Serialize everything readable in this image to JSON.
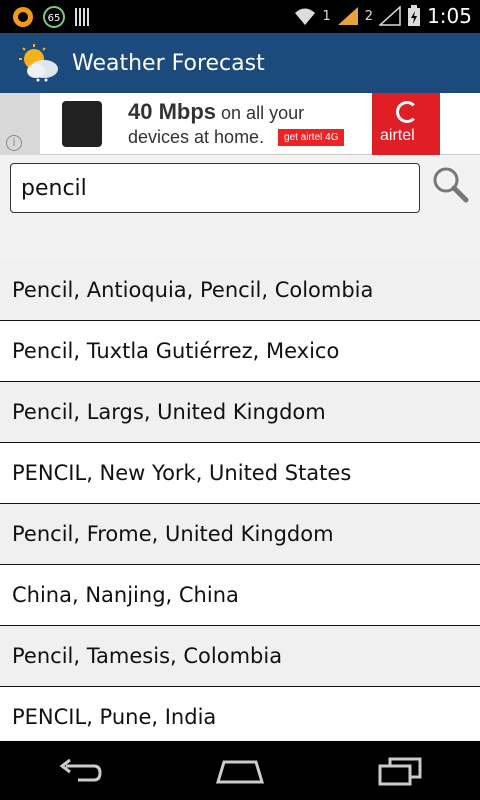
{
  "status_bar": {
    "time": "1:05",
    "badge_count": "65",
    "sim1": "1",
    "sim2": "2",
    "icons": [
      "ring-app-icon",
      "counter-badge-icon",
      "barcode-icon",
      "wifi-icon",
      "signal-icon",
      "battery-charging-icon"
    ]
  },
  "app_bar": {
    "title": "Weather Forecast",
    "icon": "weather-sun-cloud-icon"
  },
  "ad": {
    "headline_bold": "40 Mbps",
    "headline_rest": " on all your",
    "subline": "devices at home.",
    "cta": "get airtel 4G",
    "brand": "airtel",
    "info_glyph": "i"
  },
  "search": {
    "value": "pencil",
    "icon": "search-icon"
  },
  "results": [
    "Pencil, Antioquia, Pencil, Colombia",
    "Pencil, Tuxtla Gutiérrez, Mexico",
    "Pencil, Largs, United Kingdom",
    "PENCIL, New York, United States",
    "Pencil, Frome, United Kingdom",
    "China, Nanjing, China",
    "Pencil, Tamesis, Colombia",
    "PENCIL, Pune, India"
  ],
  "nav": {
    "back": "back-icon",
    "home": "home-icon",
    "recents": "recents-icon"
  },
  "colors": {
    "app_bar": "#1c4a7c",
    "ad_brand": "#e01e25"
  }
}
